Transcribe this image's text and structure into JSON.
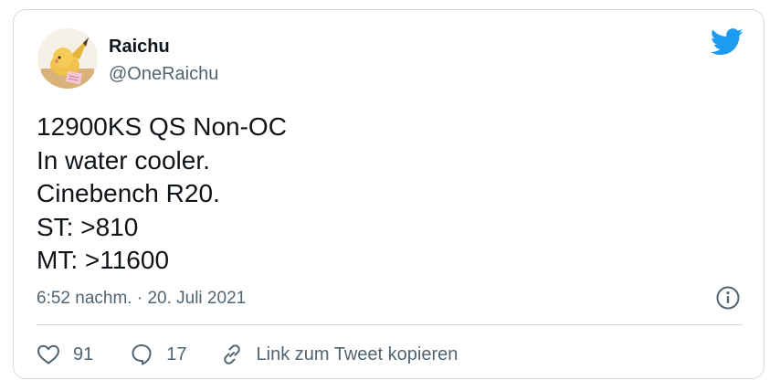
{
  "author": {
    "name": "Raichu",
    "handle": "@OneRaichu"
  },
  "tweet": {
    "lines": [
      "12900KS QS Non-OC",
      "In water cooler.",
      "Cinebench R20.",
      "ST: >810",
      "MT: >11600"
    ],
    "timestamp": "6:52 nachm. · 20. Juli 2021"
  },
  "actions": {
    "likes": "91",
    "replies": "17",
    "copy_link_label": "Link zum Tweet kopieren"
  },
  "icons": {
    "brand": "twitter-bird-icon",
    "info": "info-icon",
    "like": "heart-icon",
    "reply": "speech-bubble-icon",
    "link": "link-icon"
  },
  "colors": {
    "brand": "#1d9bf0",
    "text": "#0f1419",
    "secondary": "#536471",
    "border": "#cfd9de"
  }
}
